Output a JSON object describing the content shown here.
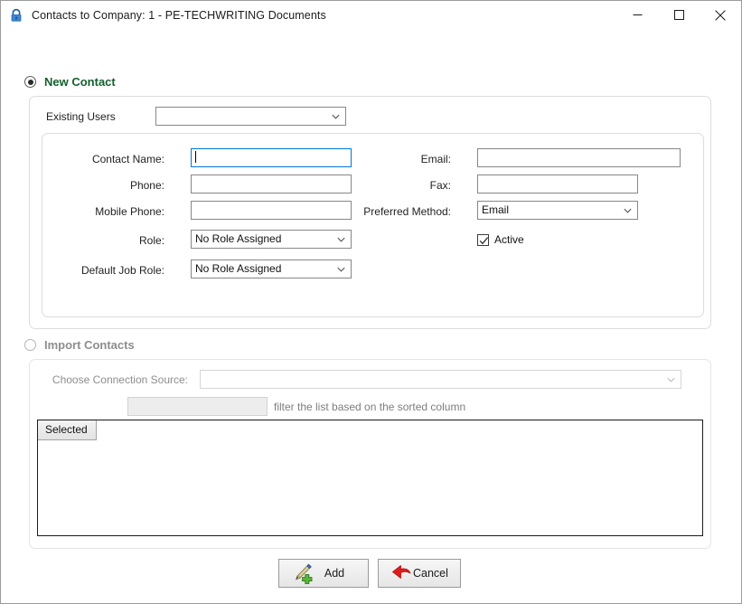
{
  "window": {
    "title": "Contacts to Company: 1 - PE-TECHWRITING Documents",
    "icon": "lock-icon",
    "controls": {
      "minimize": "minimize-icon",
      "maximize": "maximize-icon",
      "close": "close-icon"
    }
  },
  "new_contact": {
    "radio_label": "New Contact",
    "selected": true,
    "existing_users": {
      "label": "Existing Users",
      "value": "",
      "placeholder": ""
    },
    "fields": {
      "contact_name": {
        "label": "Contact Name:",
        "value": "",
        "focused": true
      },
      "phone": {
        "label": "Phone:",
        "value": ""
      },
      "mobile_phone": {
        "label": "Mobile Phone:",
        "value": ""
      },
      "role": {
        "label": "Role:",
        "value": "No Role Assigned"
      },
      "default_job_role": {
        "label": "Default Job Role:",
        "value": "No Role Assigned"
      },
      "email": {
        "label": "Email:",
        "value": ""
      },
      "fax": {
        "label": "Fax:",
        "value": ""
      },
      "preferred_method": {
        "label": "Preferred Method:",
        "value": "Email"
      },
      "active": {
        "label": "Active",
        "checked": true
      }
    }
  },
  "import_contacts": {
    "radio_label": "Import Contacts",
    "selected": false,
    "connection_source": {
      "label": "Choose Connection Source:",
      "value": ""
    },
    "filter": {
      "value": "",
      "hint": "filter the list based on the sorted column"
    },
    "grid": {
      "columns": [
        "Selected"
      ],
      "rows": []
    }
  },
  "footer": {
    "add": {
      "label": "Add",
      "icon": "pen-add-icon"
    },
    "cancel": {
      "label": "Cancel",
      "icon": "red-arrow-icon"
    }
  },
  "colors": {
    "accent_green": "#14602f",
    "focus_blue": "#0078d7",
    "disabled_gray": "#8d8d8d"
  }
}
